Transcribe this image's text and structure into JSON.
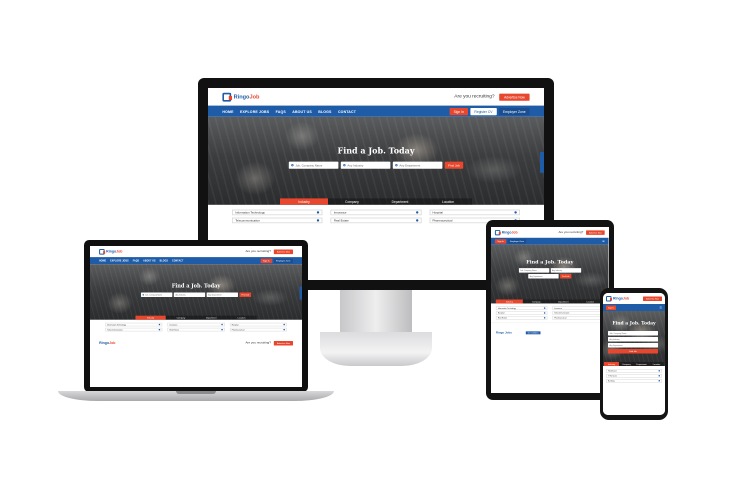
{
  "site": {
    "logo_text": "Ringo",
    "logo_accent": "Job",
    "recruiting_text": "Are you recruiting?",
    "advertise_label": "Advertise Now",
    "menu": [
      "HOME",
      "EXPLORE JOBS",
      "FAQS",
      "ABOUT US",
      "BLOGS",
      "CONTACT"
    ],
    "sign_in": "Sign In",
    "register": "Register CV",
    "employer_zone": "Employer Zone",
    "hero_title": "Find a Job. Today",
    "search_keyword_placeholder": "Job, Company Name",
    "search_industry": "Any Industry",
    "search_department": "Any Department",
    "find_button": "Find Job",
    "tabs": [
      "Industry",
      "Company",
      "Department",
      "Location"
    ],
    "categories": [
      "Information Technology",
      "Insurance",
      "Hospital",
      "Telecommunication",
      "Real Estate",
      "Pharmaceutical"
    ],
    "brand_name": "Ringo Jobs",
    "brand_button": "Get Job Alerts",
    "phone_list": [
      "Healthcare",
      "IT Services",
      "Banking"
    ]
  },
  "colors": {
    "brand_blue": "#1f5ca8",
    "accent_red": "#e8472d"
  }
}
